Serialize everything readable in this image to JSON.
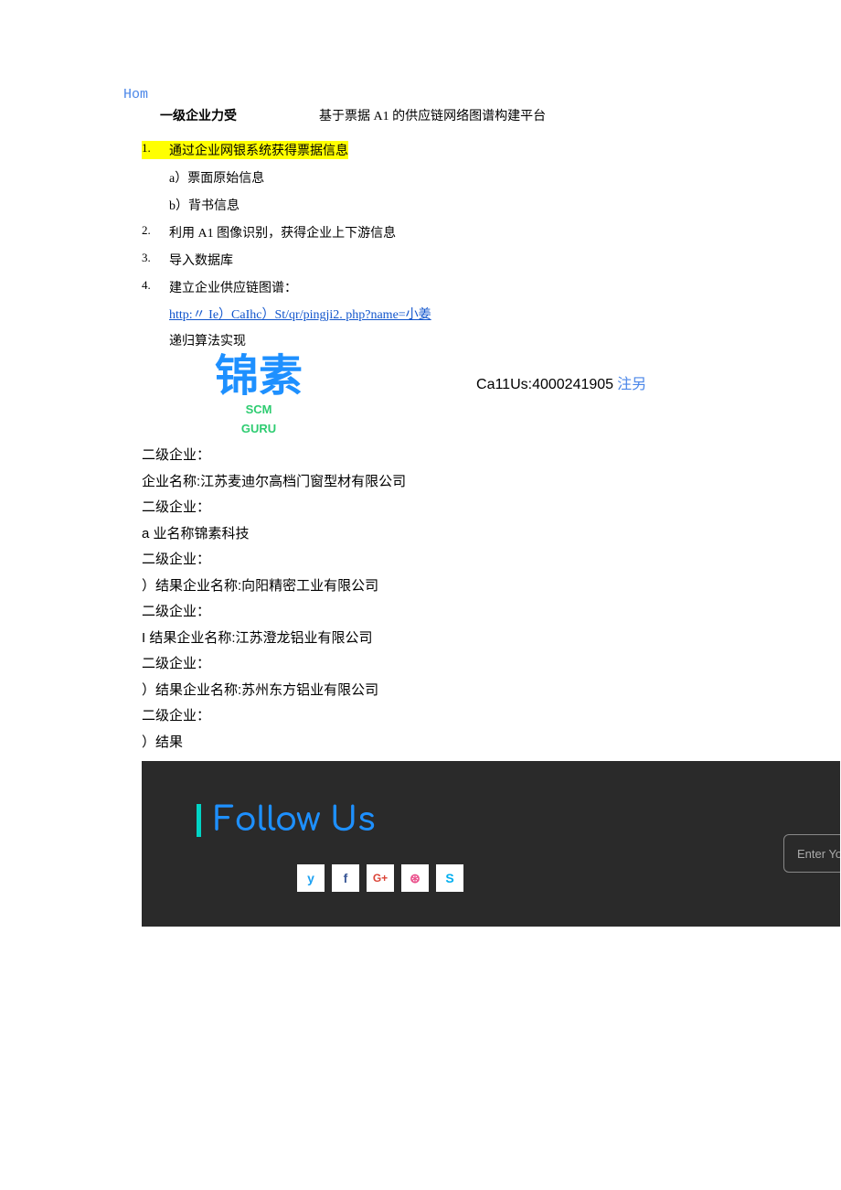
{
  "nav": {
    "home": "Hom"
  },
  "header": {
    "left_heading": "一级企业力受",
    "title": "基于票据 A1 的供应链网络图谱构建平台"
  },
  "steps": [
    {
      "num": "1.",
      "text": "通过企业网银系统获得票据信息",
      "highlighted": true,
      "sub": [
        "a）票面原始信息",
        "b）背书信息"
      ]
    },
    {
      "num": "2.",
      "text": "利用 A1 图像识别，获得企业上下游信息"
    },
    {
      "num": "3.",
      "text": "导入数据库"
    },
    {
      "num": "4.",
      "text": "建立企业供应链图谱："
    }
  ],
  "link": "http:〃 Ie）CaIhc）St/qr/pingji2. php?name=小姜",
  "algo_text": "递归算法实现",
  "logo": {
    "main": "锦素",
    "sub1": "SCM",
    "sub2": "GURU"
  },
  "callus": {
    "label": "Ca11Us:4000241905",
    "reg": " 注另"
  },
  "results": [
    "二级企业：",
    "企业名称:江苏麦迪尔高档门窗型材有限公司",
    "二级企业：",
    "a 业名称锦素科技",
    "二级企业：",
    "）结果企业名称:向阳精密工业有限公司",
    "二级企业：",
    "I 结果企业名称:江苏澄龙铝业有限公司",
    "二级企业：",
    "）结果企业名称:苏州东方铝业有限公司",
    "二级企业：",
    "）结果"
  ],
  "footer": {
    "follow": "Follow Us",
    "input_placeholder": "Enter You",
    "icons": {
      "twitter": "twitter-icon",
      "facebook": "facebook-icon",
      "google": "google-plus-icon",
      "dribbble": "dribbble-icon",
      "skype": "skype-icon"
    },
    "glyphs": {
      "tw": "y",
      "fb": "f",
      "gp": "G+",
      "dr": "⊛",
      "sk": "S"
    }
  }
}
